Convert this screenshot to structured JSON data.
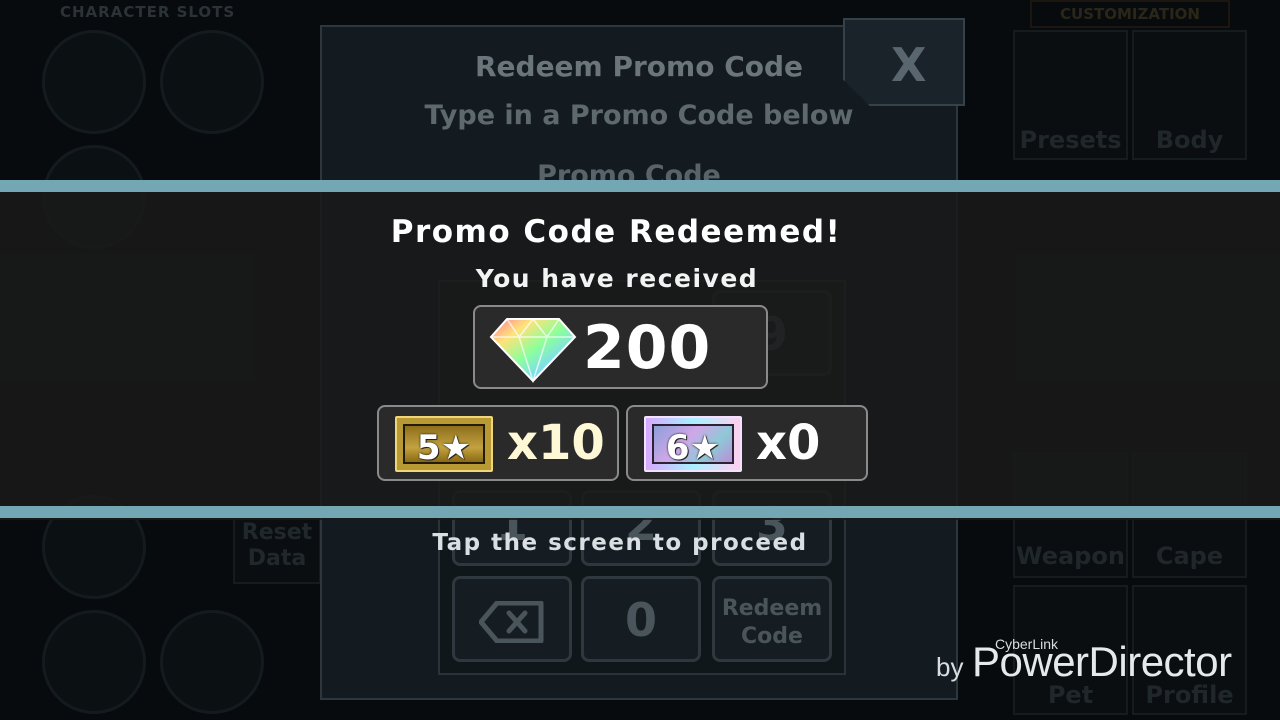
{
  "background": {
    "left_header": "CHARACTER SLOTS",
    "right_header": "CUSTOMIZATION",
    "right_tiles": [
      "Presets",
      "Body",
      "Weapon",
      "Cape",
      "Pet",
      "Profile"
    ],
    "reset_label": "Reset Data"
  },
  "modal": {
    "title": "Redeem Promo Code",
    "subtitle": "Type in a Promo Code below",
    "field_label": "Promo Code",
    "close_label": "X",
    "keys": [
      "1",
      "2",
      "3",
      "0",
      "9"
    ],
    "redeem_label_line1": "Redeem",
    "redeem_label_line2": "Code"
  },
  "reward": {
    "title": "Promo Code Redeemed!",
    "subtitle": "You have received",
    "gems": "200",
    "ticket5_label": "5★",
    "ticket5_count": "x10",
    "ticket6_label": "6★",
    "ticket6_count": "x0",
    "tap_text": "Tap the screen to proceed"
  },
  "watermark": {
    "by": "by",
    "small": "CyberLink",
    "main": "PowerDirector"
  },
  "colors": {
    "band_line": "#72a7b3",
    "band_bg": "#1a1a1a",
    "gold_ticket": "#c3a240",
    "rainbow_ticket": "#d0a6e8"
  }
}
